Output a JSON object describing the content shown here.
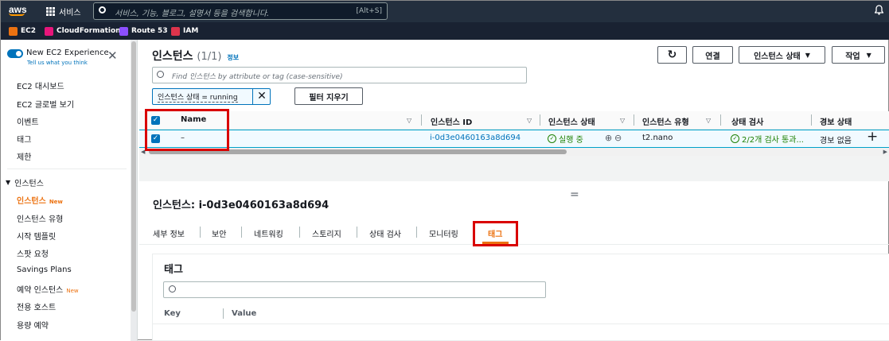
{
  "topnav": {
    "logo": "aws",
    "services": "서비스",
    "search_placeholder": "서비스, 기능, 블로그, 설명서 등을 검색합니다.",
    "shortcut": "[Alt+S]"
  },
  "favorites": [
    "EC2",
    "CloudFormation",
    "Route 53",
    "IAM"
  ],
  "sidebar": {
    "toggle_title": "New EC2 Experience",
    "toggle_sub": "Tell us what you think",
    "items": [
      "EC2 대시보드",
      "EC2 글로벌 보기",
      "이벤트",
      "태그",
      "제한"
    ],
    "section": "인스턴스",
    "section_items": [
      {
        "label": "인스턴스",
        "badge": "New"
      },
      {
        "label": "인스턴스 유형"
      },
      {
        "label": "시작 템플릿"
      },
      {
        "label": "스팟 요청"
      },
      {
        "label": "Savings Plans"
      },
      {
        "label": "예약 인스턴스",
        "badge": "New"
      },
      {
        "label": "전용 호스트"
      },
      {
        "label": "용량 예약"
      }
    ]
  },
  "main": {
    "title": "인스턴스",
    "count": "(1/1)",
    "info": "정보",
    "connect": "연결",
    "state_btn": "인스턴스 상태",
    "actions_btn": "작업",
    "search_placeholder": "Find 인스턴스 by attribute or tag (case-sensitive)",
    "filter_token": "인스턴스 상태 = running",
    "clear_filters": "필터 지우기"
  },
  "table": {
    "headers": [
      "Name",
      "인스턴스 ID",
      "인스턴스 상태",
      "인스턴스 유형",
      "상태 검사",
      "경보 상태"
    ],
    "row": {
      "name": "–",
      "id": "i-0d3e0460163a8d694",
      "state": "실행 중",
      "type": "t2.nano",
      "check": "2/2개 검사 통과...",
      "alarm": "경보 없음"
    }
  },
  "detail": {
    "title": "인스턴스: i-0d3e0460163a8d694",
    "tabs": [
      "세부 정보",
      "보안",
      "네트워킹",
      "스토리지",
      "상태 검사",
      "모니터링",
      "태그"
    ],
    "section_title": "태그",
    "col_key": "Key",
    "col_value": "Value"
  },
  "colors": {
    "accent": "#0073bb",
    "active_tab": "#ec7211",
    "success": "#1d8102",
    "highlight": "#d90000"
  }
}
